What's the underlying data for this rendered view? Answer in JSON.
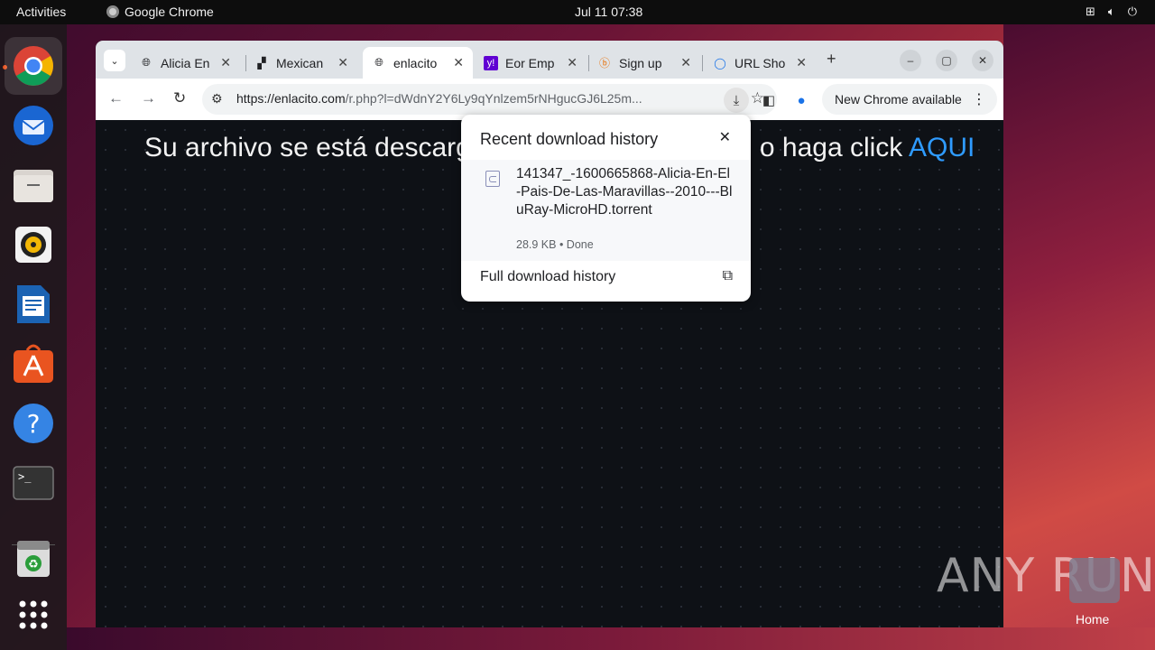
{
  "topbar": {
    "activities": "Activities",
    "app_name": "Google Chrome",
    "clock": "Jul 11  07:38"
  },
  "dock": {
    "items": [
      "chrome",
      "thunderbird",
      "files",
      "rhythmbox",
      "libreoffice-writer",
      "app-center",
      "help",
      "terminal",
      "trash",
      "show-apps"
    ]
  },
  "browser": {
    "tabs": [
      {
        "title": "Alicia En",
        "icon": "globe-icon"
      },
      {
        "title": "Mexican",
        "icon": "site-icon"
      },
      {
        "title": "enlacito",
        "icon": "globe-icon",
        "active": true
      },
      {
        "title": "Eor Emp",
        "icon": "yahoo-icon"
      },
      {
        "title": "Sign up",
        "icon": "site-icon"
      },
      {
        "title": "URL Sho",
        "icon": "site-icon"
      }
    ],
    "url_host": "https://enlacito.com",
    "url_path": "/r.php?l=dWdnY2Y6Ly9qYnlzem5rNHgucGJ6L25m...",
    "chrome_available": "New Chrome available"
  },
  "page": {
    "heading_left": "Su archivo se está descarg",
    "heading_right": "o haga click ",
    "link": "AQUI"
  },
  "download_popup": {
    "title": "Recent download history",
    "file_name": "141347_-1600665868-Alicia-En-El-Pais-De-Las-Maravillas--2010---BluRay-MicroHD.torrent",
    "file_meta": "28.9 KB • Done",
    "full_history": "Full download history"
  },
  "watermark": "ANY RUN",
  "desktop": {
    "home_label": "Home"
  },
  "colors": {
    "accent_link": "#2f9bff",
    "ubuntu_orange": "#e95420"
  }
}
